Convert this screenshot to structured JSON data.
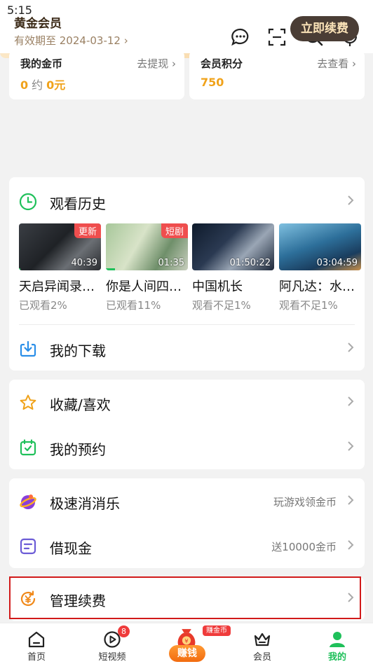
{
  "status_bar": {
    "time": "5:15"
  },
  "top_bar": {
    "icons": [
      "chat-icon",
      "scan-icon",
      "search-icon",
      "microphone-icon"
    ]
  },
  "stats": [
    {
      "title": "我的金币",
      "link": "去提现",
      "value_a": "0",
      "unit": "约",
      "value_b": "0元"
    },
    {
      "title": "会员积分",
      "link": "去查看",
      "value": "750"
    }
  ],
  "vip": {
    "title": "黄金会员",
    "expiry": "有效期至 2024-03-12",
    "button": "立即续费",
    "colors": {
      "start": "#fbe7c6",
      "end": "#f6cf95",
      "button": "#4a3d35"
    }
  },
  "history": {
    "label": "观看历史",
    "items": [
      {
        "title": "天启异闻录…",
        "progress_text": "已观看2%",
        "duration": "40:39",
        "badge": "更新",
        "progress": 0.02
      },
      {
        "title": "你是人间四…",
        "progress_text": "已观看11%",
        "duration": "01:35",
        "badge": "短剧",
        "progress": 0.11
      },
      {
        "title": "中国机长",
        "progress_text": "观看不足1%",
        "duration": "01:50:22",
        "badge": "",
        "progress": 0
      },
      {
        "title": "阿凡达：水…",
        "progress_text": "观看不足1%",
        "duration": "03:04:59",
        "badge": "",
        "progress": 0
      }
    ]
  },
  "download": {
    "label": "我的下载"
  },
  "collect": {
    "label": "收藏/喜欢"
  },
  "reserve": {
    "label": "我的预约"
  },
  "game": {
    "label": "极速消消乐",
    "right": "玩游戏领金币"
  },
  "cash": {
    "label": "借现金",
    "right": "送10000金币"
  },
  "renew": {
    "label": "管理续费"
  },
  "bottom_nav": {
    "items": [
      {
        "label": "首页",
        "icon": "home-icon"
      },
      {
        "label": "短视频",
        "icon": "play-circle-icon",
        "badge": "8"
      },
      {
        "label": "赚钱",
        "icon": "money-bag-icon",
        "badge": "赚金币"
      },
      {
        "label": "会员",
        "icon": "crown-icon"
      },
      {
        "label": "我的",
        "icon": "user-icon",
        "active": true
      }
    ],
    "active_color": "#1fc05a"
  },
  "accent_color": "#1fc05a"
}
